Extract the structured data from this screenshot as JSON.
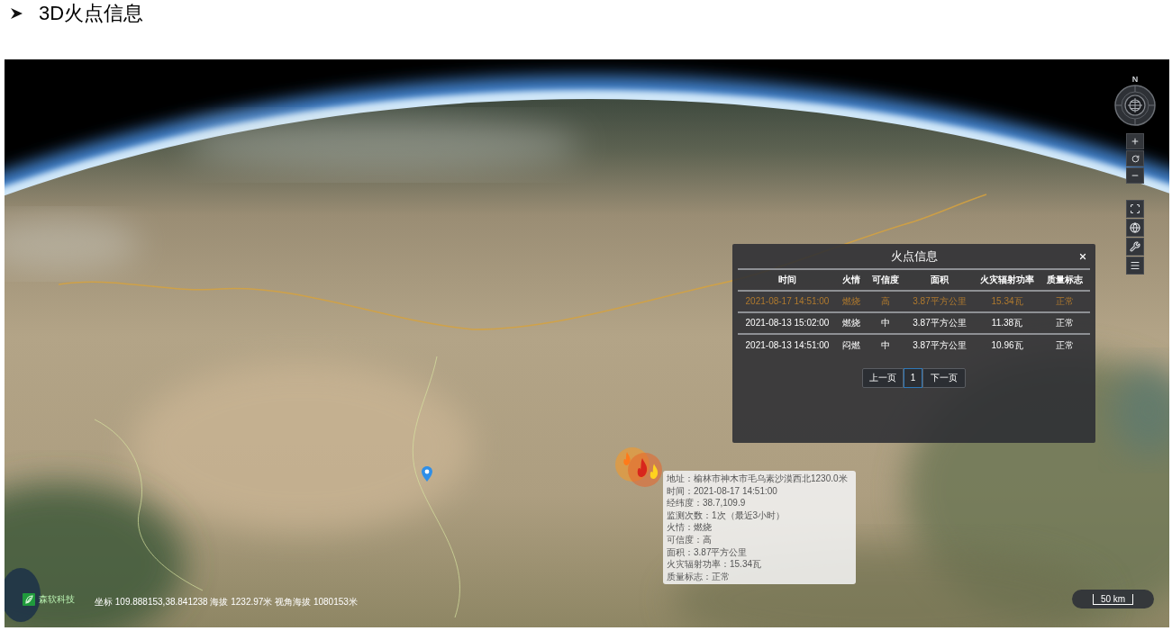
{
  "heading": {
    "title": "3D火点信息"
  },
  "map": {
    "compass": {
      "north_label": "N"
    },
    "scale_bar": {
      "label": "50 km"
    },
    "status_bar": {
      "brand": "森软科技",
      "coordinates": "坐标 109.888153,38.841238 海拔 1232.97米 视角海拔 1080153米"
    }
  },
  "fire_info_panel": {
    "title": "火点信息",
    "columns": [
      "时间",
      "火情",
      "可信度",
      "面积",
      "火灾辐射功率",
      "质量标志"
    ],
    "rows": [
      {
        "cells": [
          "2021-08-17 14:51:00",
          "燃烧",
          "高",
          "3.87平方公里",
          "15.34瓦",
          "正常"
        ],
        "selected": true
      },
      {
        "cells": [
          "2021-08-13 15:02:00",
          "燃烧",
          "中",
          "3.87平方公里",
          "11.38瓦",
          "正常"
        ],
        "selected": false
      },
      {
        "cells": [
          "2021-08-13 14:51:00",
          "闷燃",
          "中",
          "3.87平方公里",
          "10.96瓦",
          "正常"
        ],
        "selected": false
      }
    ],
    "pagination": {
      "previous": "上一页",
      "pages": [
        {
          "label": "1",
          "selected": true
        }
      ],
      "next": "下一页"
    }
  },
  "fire_tooltip": {
    "lines": [
      "地址：榆林市神木市毛乌素沙漠西北1230.0米",
      "时间：2021-08-17 14:51:00",
      "经纬度：38.7,109.9",
      "监测次数：1次（最近3小时）",
      "火情：燃烧",
      "可信度：高",
      "面积：3.87平方公里",
      "火灾辐射功率：15.34瓦",
      "质量标志：正常"
    ]
  }
}
